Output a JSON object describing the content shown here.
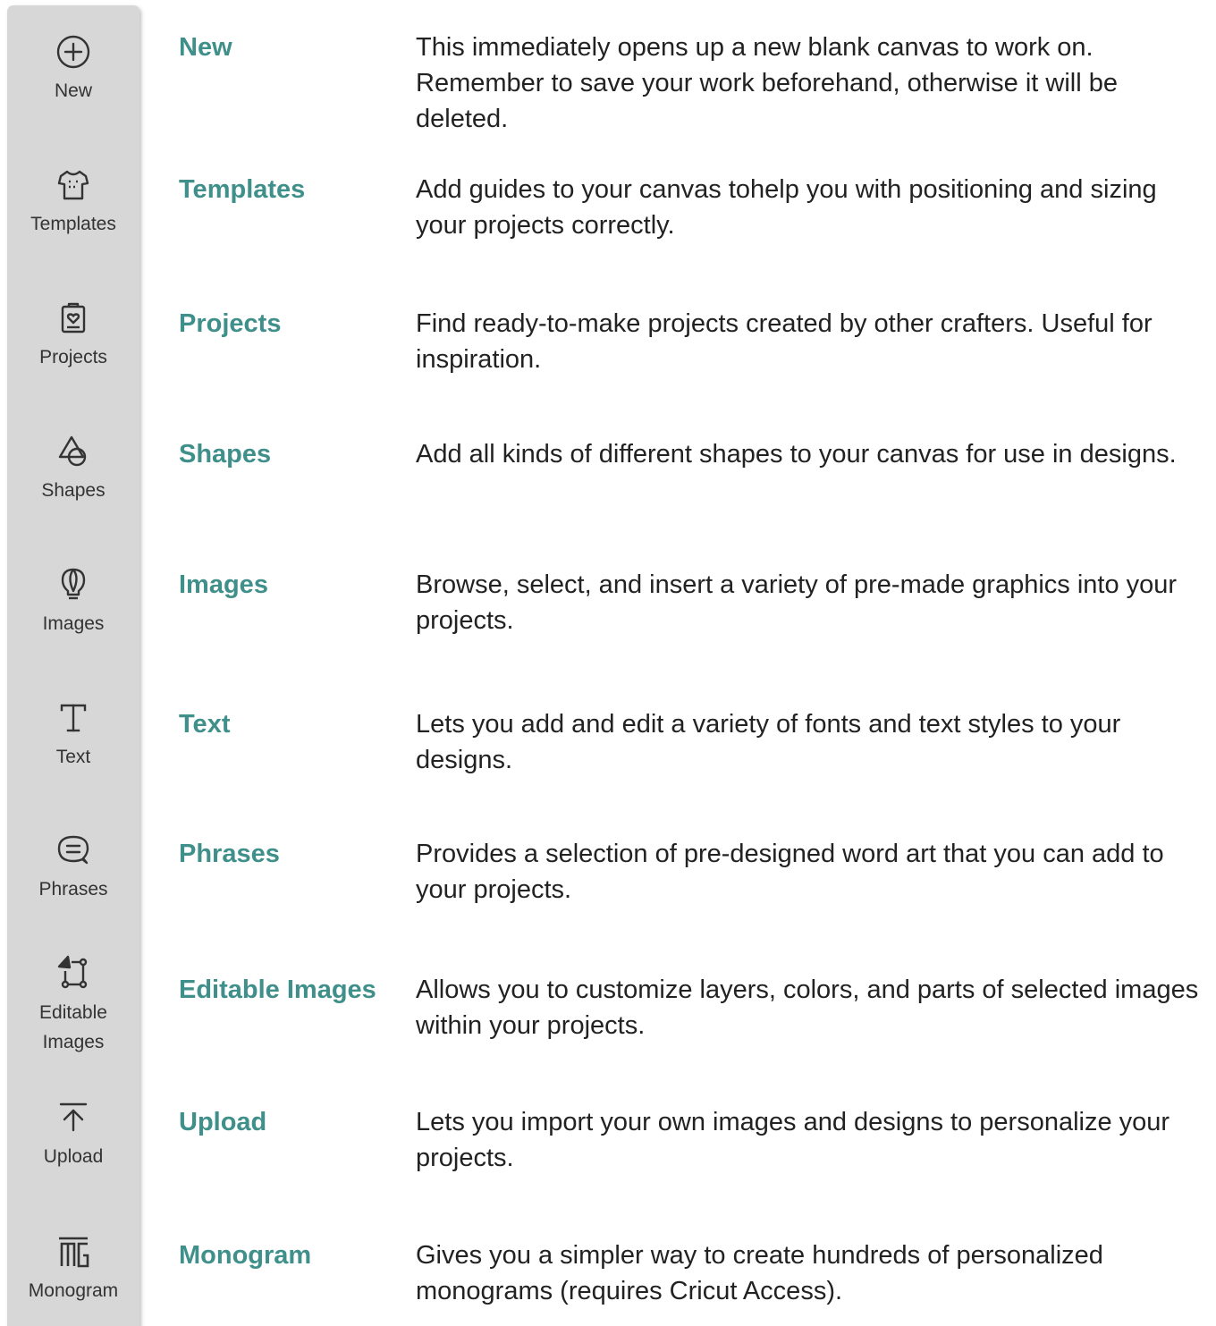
{
  "sidebar": {
    "items": [
      {
        "label": "New",
        "icon": "plus-circle-icon"
      },
      {
        "label": "Templates",
        "icon": "tshirt-icon"
      },
      {
        "label": "Projects",
        "icon": "clipboard-heart-icon"
      },
      {
        "label": "Shapes",
        "icon": "shapes-icon"
      },
      {
        "label": "Images",
        "icon": "lightbulb-icon"
      },
      {
        "label": "Text",
        "icon": "text-t-icon"
      },
      {
        "label": "Phrases",
        "icon": "speech-bubble-icon"
      },
      {
        "label": "Editable\nImages",
        "icon": "editable-images-icon"
      },
      {
        "label": "Upload",
        "icon": "upload-arrow-icon"
      },
      {
        "label": "Monogram",
        "icon": "monogram-icon"
      }
    ]
  },
  "rows": [
    {
      "title": "New",
      "description": "This immediately opens up a new blank canvas to work on. Remember to save your work beforehand, otherwise it will be deleted."
    },
    {
      "title": "Templates",
      "description": "Add guides to your canvas tohelp you with positioning and sizing your projects correctly."
    },
    {
      "title": "Projects",
      "description": "Find ready-to-make projects created by other crafters. Useful for inspiration."
    },
    {
      "title": "Shapes",
      "description": "Add all kinds of different shapes to your canvas for use in designs."
    },
    {
      "title": "Images",
      "description": "Browse, select, and insert a variety of pre-made graphics into your projects."
    },
    {
      "title": "Text",
      "description": "Lets you add and edit a variety of fonts and text styles to your designs."
    },
    {
      "title": "Phrases",
      "description": "Provides a selection of pre-designed word art that you can add to your projects."
    },
    {
      "title": "Editable Images",
      "description": "Allows you to customize layers, colors, and parts of selected images within your projects."
    },
    {
      "title": "Upload",
      "description": "Lets you import your own images and designs to personalize your projects."
    },
    {
      "title": "Monogram",
      "description": "Gives you a simpler way to create hundreds of personalized monograms (requires Cricut Access)."
    }
  ],
  "colors": {
    "accent": "#3f8f8a",
    "sidebar_bg": "#d7d7d7",
    "text": "#222222"
  }
}
